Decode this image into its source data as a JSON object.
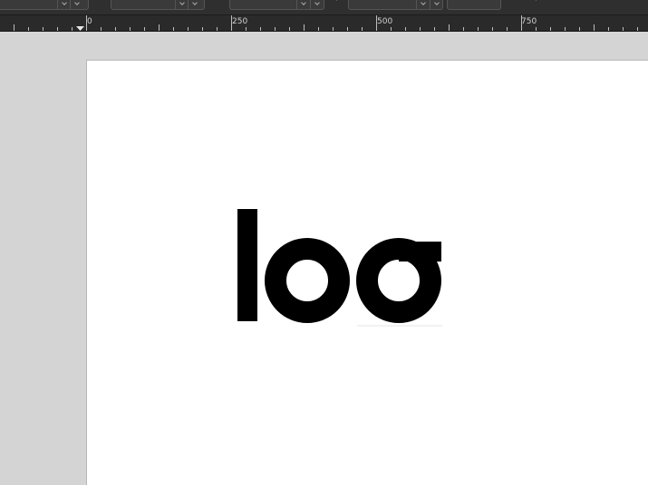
{
  "ruler": {
    "labels": [
      "0",
      "250",
      "500",
      "750"
    ]
  },
  "document": {
    "logo_text": "log",
    "logo_color": "#000000",
    "page_color": "#ffffff",
    "workspace_color": "#d4d4d4"
  },
  "colors": {
    "toolbar_bg": "#2f2f2f",
    "ruler_bg": "#2a2a2a"
  }
}
